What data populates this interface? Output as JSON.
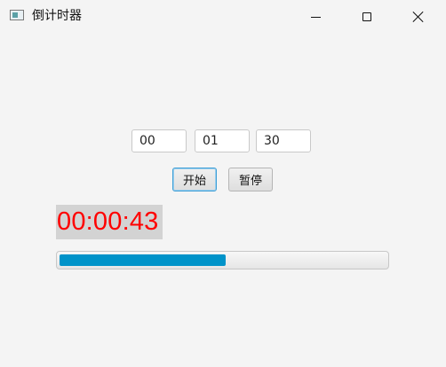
{
  "window": {
    "title": "倒计时器",
    "icon": "app-window-icon"
  },
  "inputs": {
    "hours": "00",
    "minutes": "01",
    "seconds": "30"
  },
  "buttons": {
    "start_label": "开始",
    "pause_label": "暂停"
  },
  "timer": {
    "display": "00:00:43",
    "text_color": "#ff0000",
    "background_color": "#d3d3d3"
  },
  "progress": {
    "fraction": 0.51,
    "fill_color": "#0093c9"
  },
  "colors": {
    "accent": "#3f9fd6"
  }
}
